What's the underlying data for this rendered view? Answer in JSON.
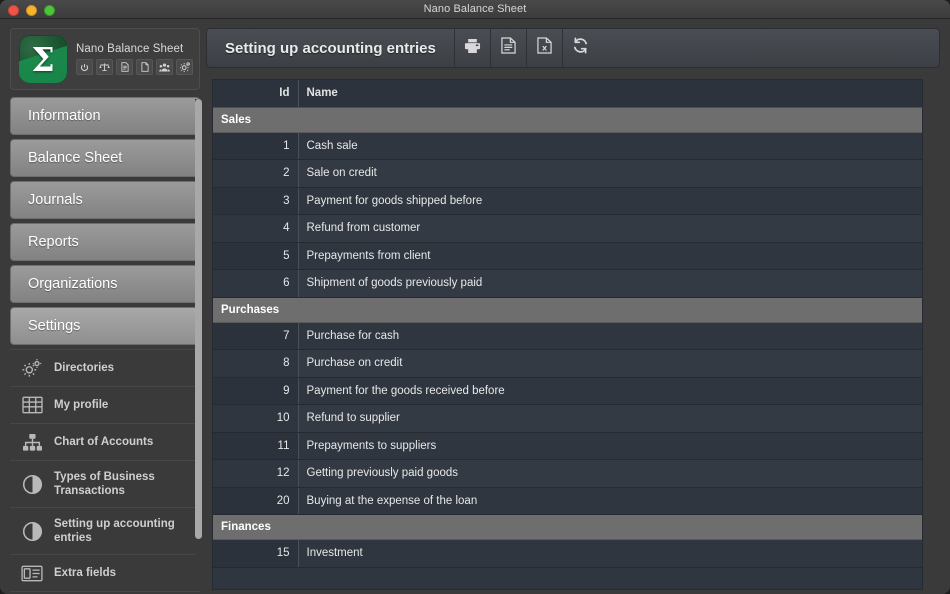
{
  "window": {
    "title": "Nano Balance Sheet",
    "controls": [
      "close",
      "minimize",
      "zoom"
    ]
  },
  "brand": {
    "name": "Nano Balance Sheet",
    "logo_glyph": "Σ",
    "mini_buttons": [
      {
        "name": "power-icon",
        "label": "Power"
      },
      {
        "name": "balance-scale-icon",
        "label": "Balance"
      },
      {
        "name": "document-lines-icon",
        "label": "Document"
      },
      {
        "name": "blank-page-icon",
        "label": "New page"
      },
      {
        "name": "users-group-icon",
        "label": "Users"
      },
      {
        "name": "gear-icon",
        "label": "Settings"
      }
    ]
  },
  "sidebar": {
    "nav": [
      {
        "label": "Information",
        "active": false
      },
      {
        "label": "Balance Sheet",
        "active": false
      },
      {
        "label": "Journals",
        "active": false
      },
      {
        "label": "Reports",
        "active": false
      },
      {
        "label": "Organizations",
        "active": false
      },
      {
        "label": "Settings",
        "active": true
      }
    ],
    "subnav": [
      {
        "label": "Directories",
        "icon": "gears-icon",
        "selected": false
      },
      {
        "label": "My profile",
        "icon": "table-grid-icon",
        "selected": false
      },
      {
        "label": "Chart of Accounts",
        "icon": "hierarchy-icon",
        "selected": false
      },
      {
        "label": "Types of Business Transactions",
        "icon": "half-circle-icon",
        "selected": false
      },
      {
        "label": "Setting up accounting entries",
        "icon": "half-circle-icon",
        "selected": true
      },
      {
        "label": "Extra fields",
        "icon": "id-card-icon",
        "selected": false
      }
    ]
  },
  "toolbar": {
    "title": "Setting up accounting entries",
    "buttons": [
      {
        "name": "print-button",
        "icon": "printer-icon",
        "label": "Print"
      },
      {
        "name": "export-doc-button",
        "icon": "document-icon",
        "label": "Document"
      },
      {
        "name": "export-excel-button",
        "icon": "excel-icon",
        "label": "Excel"
      },
      {
        "name": "refresh-button",
        "icon": "refresh-icon",
        "label": "Refresh"
      }
    ]
  },
  "table": {
    "columns": [
      "Id",
      "Name"
    ],
    "rows": [
      {
        "type": "group",
        "label": "Sales"
      },
      {
        "type": "data",
        "id": "1",
        "name": "Cash sale"
      },
      {
        "type": "data",
        "id": "2",
        "name": "Sale on credit"
      },
      {
        "type": "data",
        "id": "3",
        "name": "Payment for goods shipped before"
      },
      {
        "type": "data",
        "id": "4",
        "name": "Refund from customer"
      },
      {
        "type": "data",
        "id": "5",
        "name": "Prepayments from client"
      },
      {
        "type": "data",
        "id": "6",
        "name": "Shipment of goods previously paid"
      },
      {
        "type": "group",
        "label": "Purchases"
      },
      {
        "type": "data",
        "id": "7",
        "name": "Purchase for cash"
      },
      {
        "type": "data",
        "id": "8",
        "name": "Purchase on credit"
      },
      {
        "type": "data",
        "id": "9",
        "name": "Payment for the goods received before"
      },
      {
        "type": "data",
        "id": "10",
        "name": "Refund to supplier"
      },
      {
        "type": "data",
        "id": "11",
        "name": "Prepayments to suppliers"
      },
      {
        "type": "data",
        "id": "12",
        "name": "Getting previously paid goods"
      },
      {
        "type": "data",
        "id": "20",
        "name": "Buying at the expense of the loan"
      },
      {
        "type": "group",
        "label": "Finances"
      },
      {
        "type": "data",
        "id": "15",
        "name": "Investment"
      }
    ]
  },
  "colors": {
    "window_bg": "#3a3a3a",
    "table_bg": "#2f3640",
    "table_alt": "#333a44",
    "group_bg": "#6e6e6e",
    "nav_button": "#8f8f8f",
    "toolbar_bg": "#43474d",
    "logo_green": "#1a9150"
  }
}
